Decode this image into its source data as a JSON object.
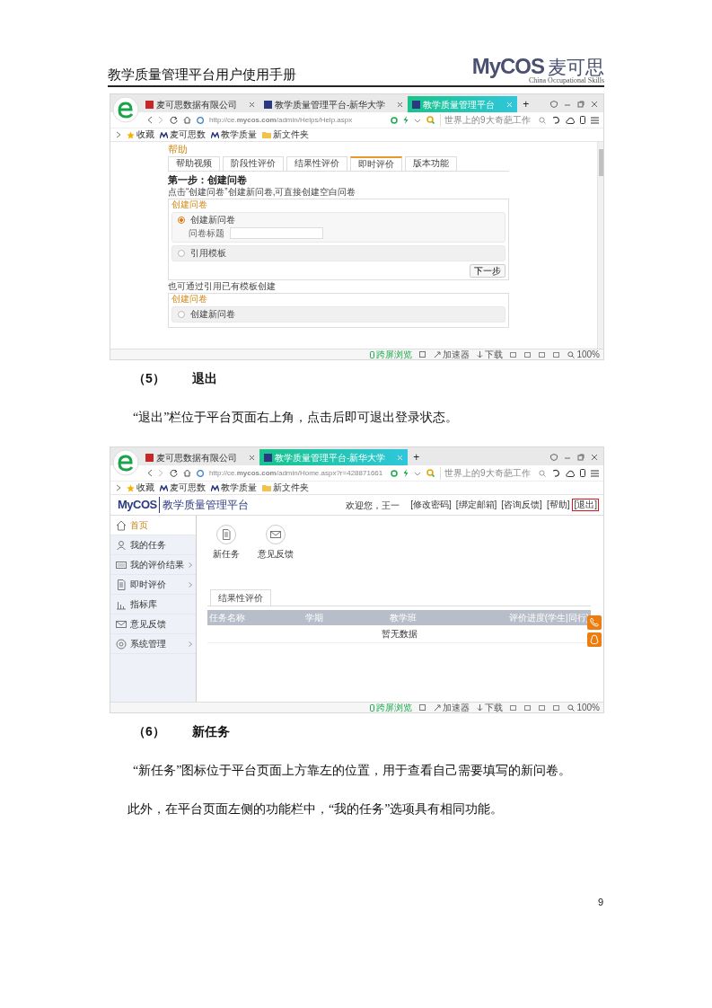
{
  "document_header": {
    "title": "教学质量管理平台用户使用手册",
    "logo_mark": "MyCOS",
    "logo_name": "麦可思",
    "logo_tagline": "China Occupational Skills"
  },
  "screenshot_help": {
    "browser": {
      "tabs": [
        {
          "label": "麦可思数据有限公司",
          "selected": false
        },
        {
          "label": "教学质量管理平台-新华大学",
          "selected": false
        },
        {
          "label": "教学质量管理平台",
          "selected": true
        }
      ],
      "new_tab": "+",
      "url": "http://ce.**mycos.com**/admin/Helps/Help.aspx",
      "search_placeholder": "世界上的9大奇葩工作",
      "bookmarks": [
        {
          "label": "收藏",
          "kind": "favorites"
        },
        {
          "label": "麦可思数",
          "kind": "site"
        },
        {
          "label": "教学质量",
          "kind": "site"
        },
        {
          "label": "新文件夹",
          "kind": "folder"
        }
      ],
      "status_bar": [
        {
          "label": "跨屏浏览",
          "kind": "phone"
        },
        {
          "label": "加速器",
          "kind": "boost"
        },
        {
          "label": "下载",
          "kind": "download"
        },
        {
          "label": "100%",
          "kind": "zoom"
        }
      ]
    },
    "page": {
      "title": "帮助",
      "tabs": [
        {
          "label": "帮助视频",
          "selected": false
        },
        {
          "label": "阶段性评价",
          "selected": false
        },
        {
          "label": "结果性评价",
          "selected": false
        },
        {
          "label": "即时评价",
          "selected": true
        },
        {
          "label": "版本功能",
          "selected": false
        }
      ],
      "step_title": "第一步：创建问卷",
      "panels": [
        {
          "intro": "点击“创建问卷”创建新问卷,可直接创建空白问卷",
          "title": "创建问卷",
          "options": [
            {
              "label": "创建新问卷",
              "selected": true,
              "field_label": "问卷标题"
            },
            {
              "label": "引用模板",
              "selected": false
            }
          ],
          "button": "下一步"
        },
        {
          "intro": "也可通过引用已有模板创建",
          "title": "创建问卷",
          "options": [
            {
              "label": "创建新问卷",
              "selected": false
            }
          ]
        }
      ]
    }
  },
  "section_5": {
    "number": "（5）",
    "title": "退出",
    "paragraphs": [
      "“退出”栏位于平台页面右上角，点击后即可退出登录状态。"
    ]
  },
  "screenshot_home": {
    "browser": {
      "tabs": [
        {
          "label": "麦可思数据有限公司",
          "selected": false
        },
        {
          "label": "教学质量管理平台-新华大学",
          "selected": true
        }
      ],
      "new_tab": "+",
      "url": "http://ce.**mycos.com**/admin/Home.aspx?r=428871661",
      "search_placeholder": "世界上的9大奇葩工作",
      "bookmarks": [
        {
          "label": "收藏",
          "kind": "favorites"
        },
        {
          "label": "麦可思数",
          "kind": "site"
        },
        {
          "label": "教学质量",
          "kind": "site"
        },
        {
          "label": "新文件夹",
          "kind": "folder"
        }
      ],
      "status_bar": [
        {
          "label": "跨屏浏览",
          "kind": "phone"
        },
        {
          "label": "加速器",
          "kind": "boost"
        },
        {
          "label": "下载",
          "kind": "download"
        },
        {
          "label": "100%",
          "kind": "zoom"
        }
      ]
    },
    "page": {
      "brand": "MyCOS",
      "title": "教学质量管理平台",
      "welcome": "欢迎您，王一",
      "links": [
        {
          "label": "[修改密码]",
          "highlighted": false
        },
        {
          "label": "[绑定邮箱]",
          "highlighted": false
        },
        {
          "label": "[咨询反馈]",
          "highlighted": false
        },
        {
          "label": "[帮助]",
          "highlighted": false
        },
        {
          "label": "[退出]",
          "highlighted": true
        }
      ],
      "sidebar": [
        {
          "label": "首页",
          "kind": "home",
          "selected": true,
          "expandable": false
        },
        {
          "label": "我的任务",
          "kind": "user",
          "selected": false,
          "expandable": false
        },
        {
          "label": "我的评价结果",
          "kind": "keyboard",
          "selected": false,
          "expandable": true
        },
        {
          "label": "即时评价",
          "kind": "document",
          "selected": false,
          "expandable": true
        },
        {
          "label": "指标库",
          "kind": "chart",
          "selected": false,
          "expandable": false
        },
        {
          "label": "意见反馈",
          "kind": "mail",
          "selected": false,
          "expandable": false
        },
        {
          "label": "系统管理",
          "kind": "gear",
          "selected": false,
          "expandable": true
        }
      ],
      "shortcuts": [
        {
          "label": "新任务",
          "kind": "document"
        },
        {
          "label": "意见反馈",
          "kind": "mail"
        }
      ],
      "tabs": [
        {
          "label": "结果性评价",
          "selected": true
        }
      ],
      "table": {
        "columns": [
          "任务名称",
          "学期",
          "教学班",
          "评价进度(学生|同行)"
        ],
        "empty_text": "暂无数据"
      },
      "float_buttons": [
        {
          "kind": "phone"
        },
        {
          "kind": "qq"
        }
      ]
    }
  },
  "section_6": {
    "number": "（6）",
    "title": "新任务",
    "paragraphs": [
      "“新任务”图标位于平台页面上方靠左的位置，用于查看自己需要填写的新问卷。",
      "此外，在平台页面左侧的功能栏中，“我的任务”选项具有相同功能。"
    ]
  },
  "page_number": "9"
}
